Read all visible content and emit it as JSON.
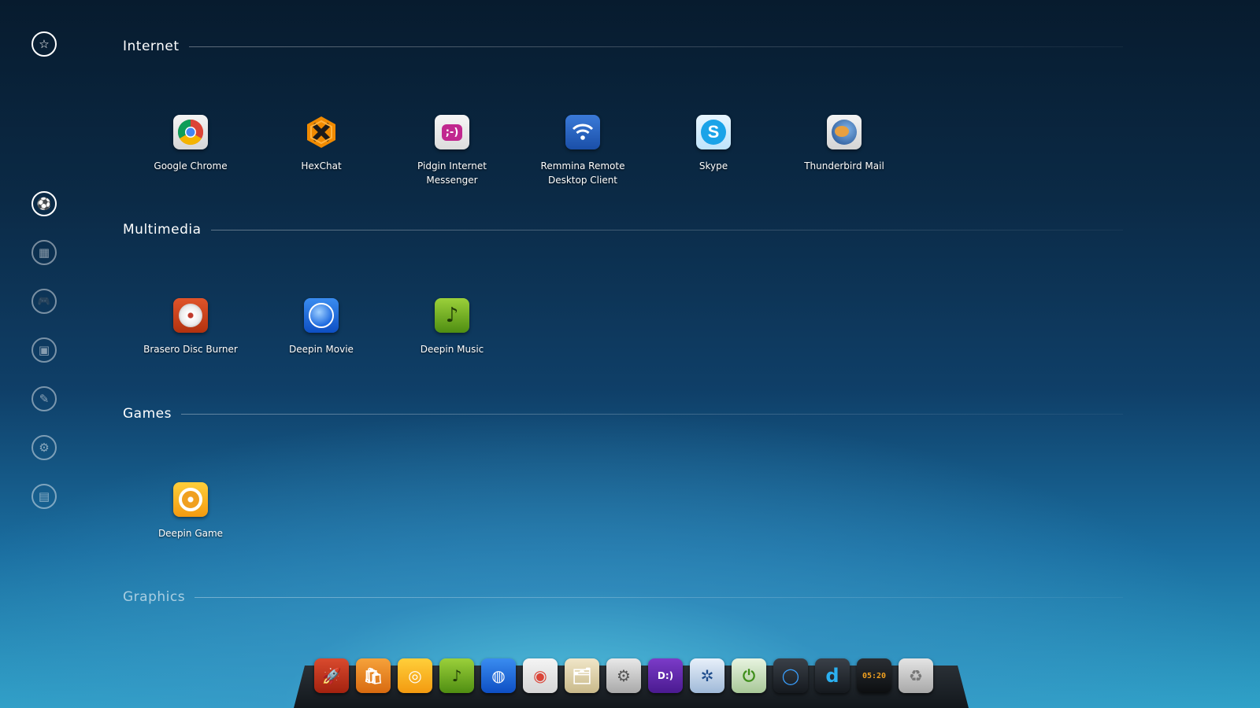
{
  "sidebar": {
    "items": [
      {
        "name": "favorites-icon",
        "glyph": "☆"
      },
      {
        "name": "internet-icon",
        "glyph": "⚽"
      },
      {
        "name": "multimedia-icon",
        "glyph": "▦"
      },
      {
        "name": "games-icon",
        "glyph": "🎮"
      },
      {
        "name": "graphics-icon",
        "glyph": "▣"
      },
      {
        "name": "office-icon",
        "glyph": "✎"
      },
      {
        "name": "system-icon",
        "glyph": "⚙"
      },
      {
        "name": "accessories-icon",
        "glyph": "▤"
      }
    ]
  },
  "categories": {
    "internet": {
      "title": "Internet",
      "apps": [
        {
          "label": "Google Chrome",
          "icon": "chrome-icon"
        },
        {
          "label": "HexChat",
          "icon": "hexchat-icon"
        },
        {
          "label": "Pidgin Internet Messenger",
          "icon": "pidgin-icon"
        },
        {
          "label": "Remmina Remote Desktop Client",
          "icon": "remmina-icon"
        },
        {
          "label": "Skype",
          "icon": "skype-icon"
        },
        {
          "label": "Thunderbird Mail",
          "icon": "thunderbird-icon"
        }
      ]
    },
    "multimedia": {
      "title": "Multimedia",
      "apps": [
        {
          "label": "Brasero Disc Burner",
          "icon": "brasero-icon"
        },
        {
          "label": "Deepin Movie",
          "icon": "deepin-movie-icon"
        },
        {
          "label": "Deepin Music",
          "icon": "deepin-music-icon"
        }
      ]
    },
    "games": {
      "title": "Games",
      "apps": [
        {
          "label": "Deepin Game",
          "icon": "deepin-game-icon"
        }
      ]
    },
    "graphics": {
      "title": "Graphics"
    }
  },
  "dock": {
    "items": [
      {
        "name": "launcher-icon",
        "glyph": "🚀"
      },
      {
        "name": "store-icon",
        "glyph": "🛍"
      },
      {
        "name": "deepin-game-icon",
        "glyph": "◎"
      },
      {
        "name": "deepin-music-icon",
        "glyph": "♪"
      },
      {
        "name": "deepin-movie-icon",
        "glyph": "◍"
      },
      {
        "name": "chrome-icon",
        "glyph": "◉"
      },
      {
        "name": "file-manager-icon",
        "glyph": "🗂"
      },
      {
        "name": "settings-icon",
        "glyph": "⚙"
      },
      {
        "name": "deepin-terminal-icon",
        "glyph": "D:)"
      },
      {
        "name": "system-info-icon",
        "glyph": "✲"
      },
      {
        "name": "power-manager-icon",
        "glyph": "⏻"
      },
      {
        "name": "screenshot-icon",
        "glyph": "◯"
      },
      {
        "name": "deepin-icon",
        "glyph": "d"
      },
      {
        "name": "clock-icon",
        "glyph": "05:20"
      },
      {
        "name": "trash-icon",
        "glyph": "♻"
      }
    ]
  }
}
